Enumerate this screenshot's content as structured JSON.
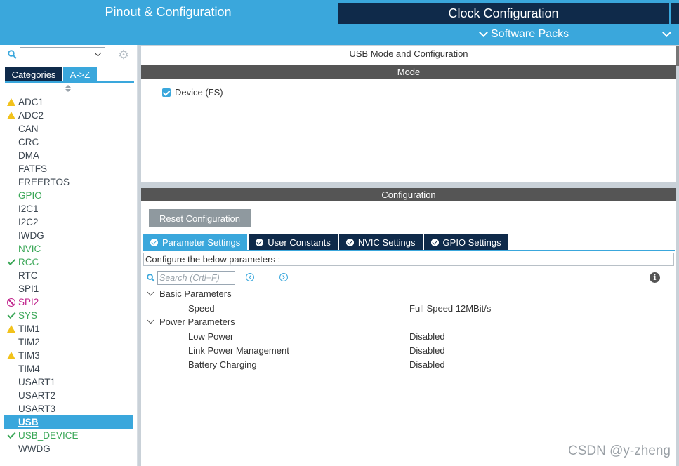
{
  "header": {
    "tab_pinout": "Pinout & Configuration",
    "tab_clock": "Clock Configuration",
    "software_packs": "Software Packs"
  },
  "left": {
    "search_placeholder": "",
    "tab_categories": "Categories",
    "tab_az": "A->Z",
    "items": [
      {
        "label": "ADC1",
        "status": "warning"
      },
      {
        "label": "ADC2",
        "status": "warning"
      },
      {
        "label": "CAN",
        "status": "none"
      },
      {
        "label": "CRC",
        "status": "none"
      },
      {
        "label": "DMA",
        "status": "none"
      },
      {
        "label": "FATFS",
        "status": "none"
      },
      {
        "label": "FREERTOS",
        "status": "none"
      },
      {
        "label": "GPIO",
        "status": "green"
      },
      {
        "label": "I2C1",
        "status": "none"
      },
      {
        "label": "I2C2",
        "status": "none"
      },
      {
        "label": "IWDG",
        "status": "none"
      },
      {
        "label": "NVIC",
        "status": "green"
      },
      {
        "label": "RCC",
        "status": "ok"
      },
      {
        "label": "RTC",
        "status": "none"
      },
      {
        "label": "SPI1",
        "status": "none"
      },
      {
        "label": "SPI2",
        "status": "disabled"
      },
      {
        "label": "SYS",
        "status": "ok"
      },
      {
        "label": "TIM1",
        "status": "warning"
      },
      {
        "label": "TIM2",
        "status": "none"
      },
      {
        "label": "TIM3",
        "status": "warning"
      },
      {
        "label": "TIM4",
        "status": "none"
      },
      {
        "label": "USART1",
        "status": "none"
      },
      {
        "label": "USART2",
        "status": "none"
      },
      {
        "label": "USART3",
        "status": "none"
      },
      {
        "label": "USB",
        "status": "selected"
      },
      {
        "label": "USB_DEVICE",
        "status": "ok"
      },
      {
        "label": "WWDG",
        "status": "none"
      }
    ]
  },
  "mode": {
    "title": "USB Mode and Configuration",
    "bar": "Mode",
    "device_label": "Device (FS)",
    "device_checked": true
  },
  "config": {
    "bar": "Configuration",
    "reset_button": "Reset Configuration",
    "tabs": [
      "Parameter Settings",
      "User Constants",
      "NVIC Settings",
      "GPIO Settings"
    ],
    "configure_text": "Configure the below parameters :",
    "search_placeholder": "Search (Crtl+F)",
    "groups": [
      {
        "name": "Basic Parameters",
        "params": [
          {
            "name": "Speed",
            "value": "Full Speed 12MBit/s"
          }
        ]
      },
      {
        "name": "Power Parameters",
        "params": [
          {
            "name": "Low Power",
            "value": "Disabled"
          },
          {
            "name": "Link Power Management",
            "value": "Disabled"
          },
          {
            "name": "Battery Charging",
            "value": "Disabled"
          }
        ]
      }
    ]
  },
  "watermark": "CSDN @y-zheng",
  "colors": {
    "accent": "#3aa7dc",
    "navy": "#0f2a4a",
    "green": "#3aa757",
    "warning": "#f2c21b",
    "magenta": "#c0228b"
  }
}
